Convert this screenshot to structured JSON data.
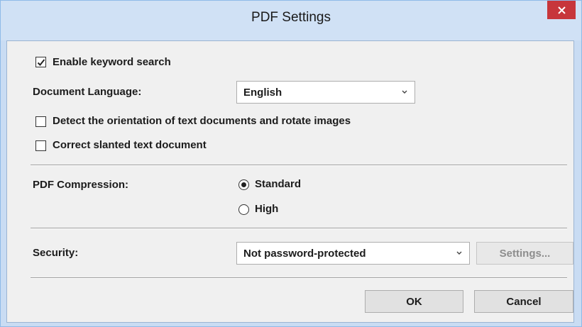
{
  "window": {
    "title": "PDF Settings",
    "close_icon": "close-icon"
  },
  "ocr": {
    "enable_keyword_search": {
      "label": "Enable keyword search",
      "checked": true
    },
    "document_language": {
      "label": "Document Language:",
      "value": "English"
    },
    "detect_orientation": {
      "label": "Detect the orientation of text documents and rotate images",
      "checked": false
    },
    "correct_slanted": {
      "label": "Correct slanted text document",
      "checked": false
    }
  },
  "compression": {
    "label": "PDF Compression:",
    "options": [
      {
        "label": "Standard",
        "selected": true
      },
      {
        "label": "High",
        "selected": false
      }
    ]
  },
  "security": {
    "label": "Security:",
    "value": "Not password-protected",
    "settings_button": "Settings..."
  },
  "footer": {
    "ok": "OK",
    "cancel": "Cancel"
  },
  "colors": {
    "title_bar": "#d0e1f5",
    "close_button": "#c7363b",
    "client_bg": "#f0f0f0"
  }
}
